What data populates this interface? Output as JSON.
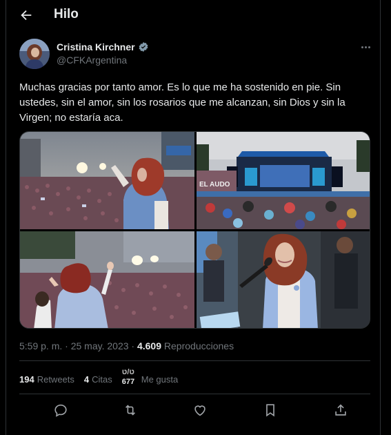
{
  "header": {
    "title": "Hilo",
    "back_icon": "arrow-left-icon"
  },
  "author": {
    "name": "Cristina Kirchner",
    "handle": "@CFKArgentina",
    "verified_icon": "verified-badge-icon"
  },
  "tweet": {
    "text": "Muchas gracias por tanto amor. Es lo que me ha sostenido en pie. Sin ustedes, sin el amor, sin los rosarios que me alcanzan, sin Dios y sin la Virgen; no estaría aca.",
    "stage_sign": "EL AUDO"
  },
  "meta": {
    "time": "5:59 p. m.",
    "separator": "·",
    "date": "25 may. 2023",
    "views_count": "4.609",
    "views_label": "Reproducciones"
  },
  "stats": {
    "retweets_count": "194",
    "retweets_label": "Retweets",
    "quotes_count": "4",
    "quotes_label": "Citas",
    "likes_count_top": "ט/ט",
    "likes_count_bottom": "677",
    "likes_label": "Me gusta"
  },
  "colors": {
    "background": "#000000",
    "text": "#e7e9ea",
    "muted": "#71767b",
    "border": "#2f3336",
    "verified": "#829aab"
  }
}
